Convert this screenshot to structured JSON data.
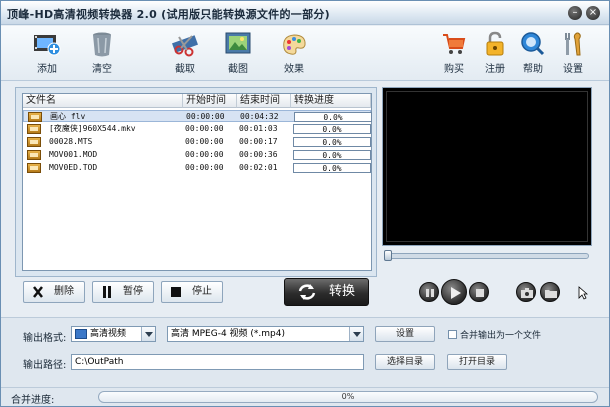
{
  "window": {
    "title": "顶峰-HD高清视频转换器 2.0 (试用版只能转换源文件的一部分)",
    "minimize_glyph": "–",
    "close_glyph": "×"
  },
  "toolbar": {
    "add": "添加",
    "clear": "清空",
    "clip": "截取",
    "screenshot": "截图",
    "effects": "效果",
    "buy": "购买",
    "register": "注册",
    "help": "帮助",
    "settings": "设置"
  },
  "file_list": {
    "columns": [
      "文件名",
      "开始时间",
      "结束时间",
      "转换进度"
    ],
    "rows": [
      {
        "name": "画心 flv",
        "start": "00:00:00",
        "end": "00:04:32",
        "progress": "0.0%"
      },
      {
        "name": "[夜魔侠]960X544.mkv",
        "start": "00:00:00",
        "end": "00:01:03",
        "progress": "0.0%"
      },
      {
        "name": "00028.MTS",
        "start": "00:00:00",
        "end": "00:00:17",
        "progress": "0.0%"
      },
      {
        "name": "MOV001.MOD",
        "start": "00:00:00",
        "end": "00:00:36",
        "progress": "0.0%"
      },
      {
        "name": "MOV0ED.TOD",
        "start": "00:00:00",
        "end": "00:02:01",
        "progress": "0.0%"
      }
    ]
  },
  "actions": {
    "delete": "删除",
    "pause": "暂停",
    "stop": "停止",
    "convert": "转换"
  },
  "output": {
    "format_label": "输出格式:",
    "category": "高清视频",
    "format": "高清 MPEG-4 视频 (*.mp4)",
    "settings_button": "设置",
    "merge_checkbox": "合并输出为一个文件",
    "path_label": "输出路径:",
    "path": "C:\\OutPath",
    "choose_dir": "选择目录",
    "open_dir": "打开目录"
  },
  "status": {
    "merge_label": "合并进度:",
    "merge_progress": "0%"
  }
}
